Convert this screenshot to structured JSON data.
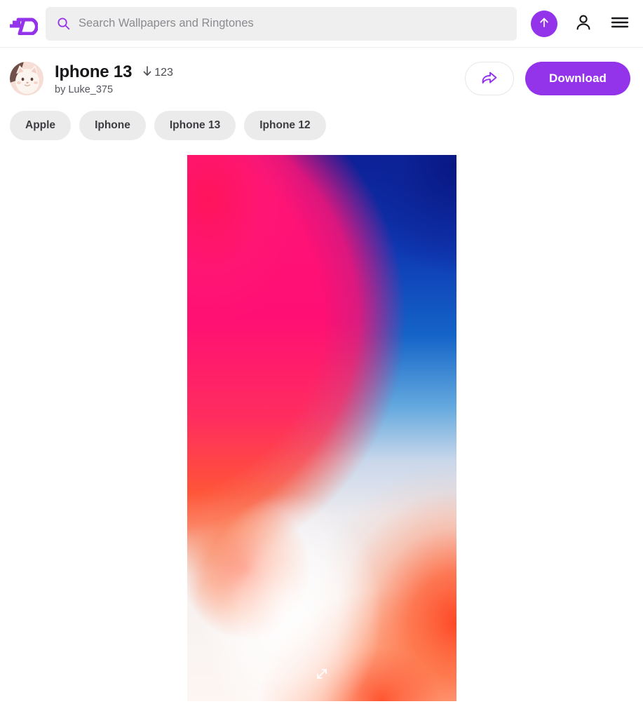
{
  "header": {
    "logo_name": "zedge-logo",
    "search": {
      "placeholder": "Search Wallpapers and Ringtones",
      "value": "",
      "icon": "search-icon"
    },
    "upload_icon": "upload-arrow-icon",
    "account_icon": "user-account-icon",
    "menu_icon": "hamburger-menu-icon"
  },
  "item": {
    "avatar_alt": "cat-avatar",
    "title": "Iphone 13",
    "download_count": "123",
    "download_icon": "download-arrow-icon",
    "byline": "by Luke_375",
    "share_icon": "share-arrow-icon",
    "download_label": "Download"
  },
  "tags": [
    {
      "label": "Apple"
    },
    {
      "label": "Iphone"
    },
    {
      "label": "Iphone 13"
    },
    {
      "label": "Iphone 12"
    }
  ],
  "wallpaper": {
    "expand_icon": "expand-fullscreen-icon"
  },
  "colors": {
    "accent_purple": "#9333ea",
    "search_bg": "#efefef",
    "tag_bg": "#ebebeb",
    "text_dark": "#17171a",
    "text_muted": "#55555d"
  }
}
